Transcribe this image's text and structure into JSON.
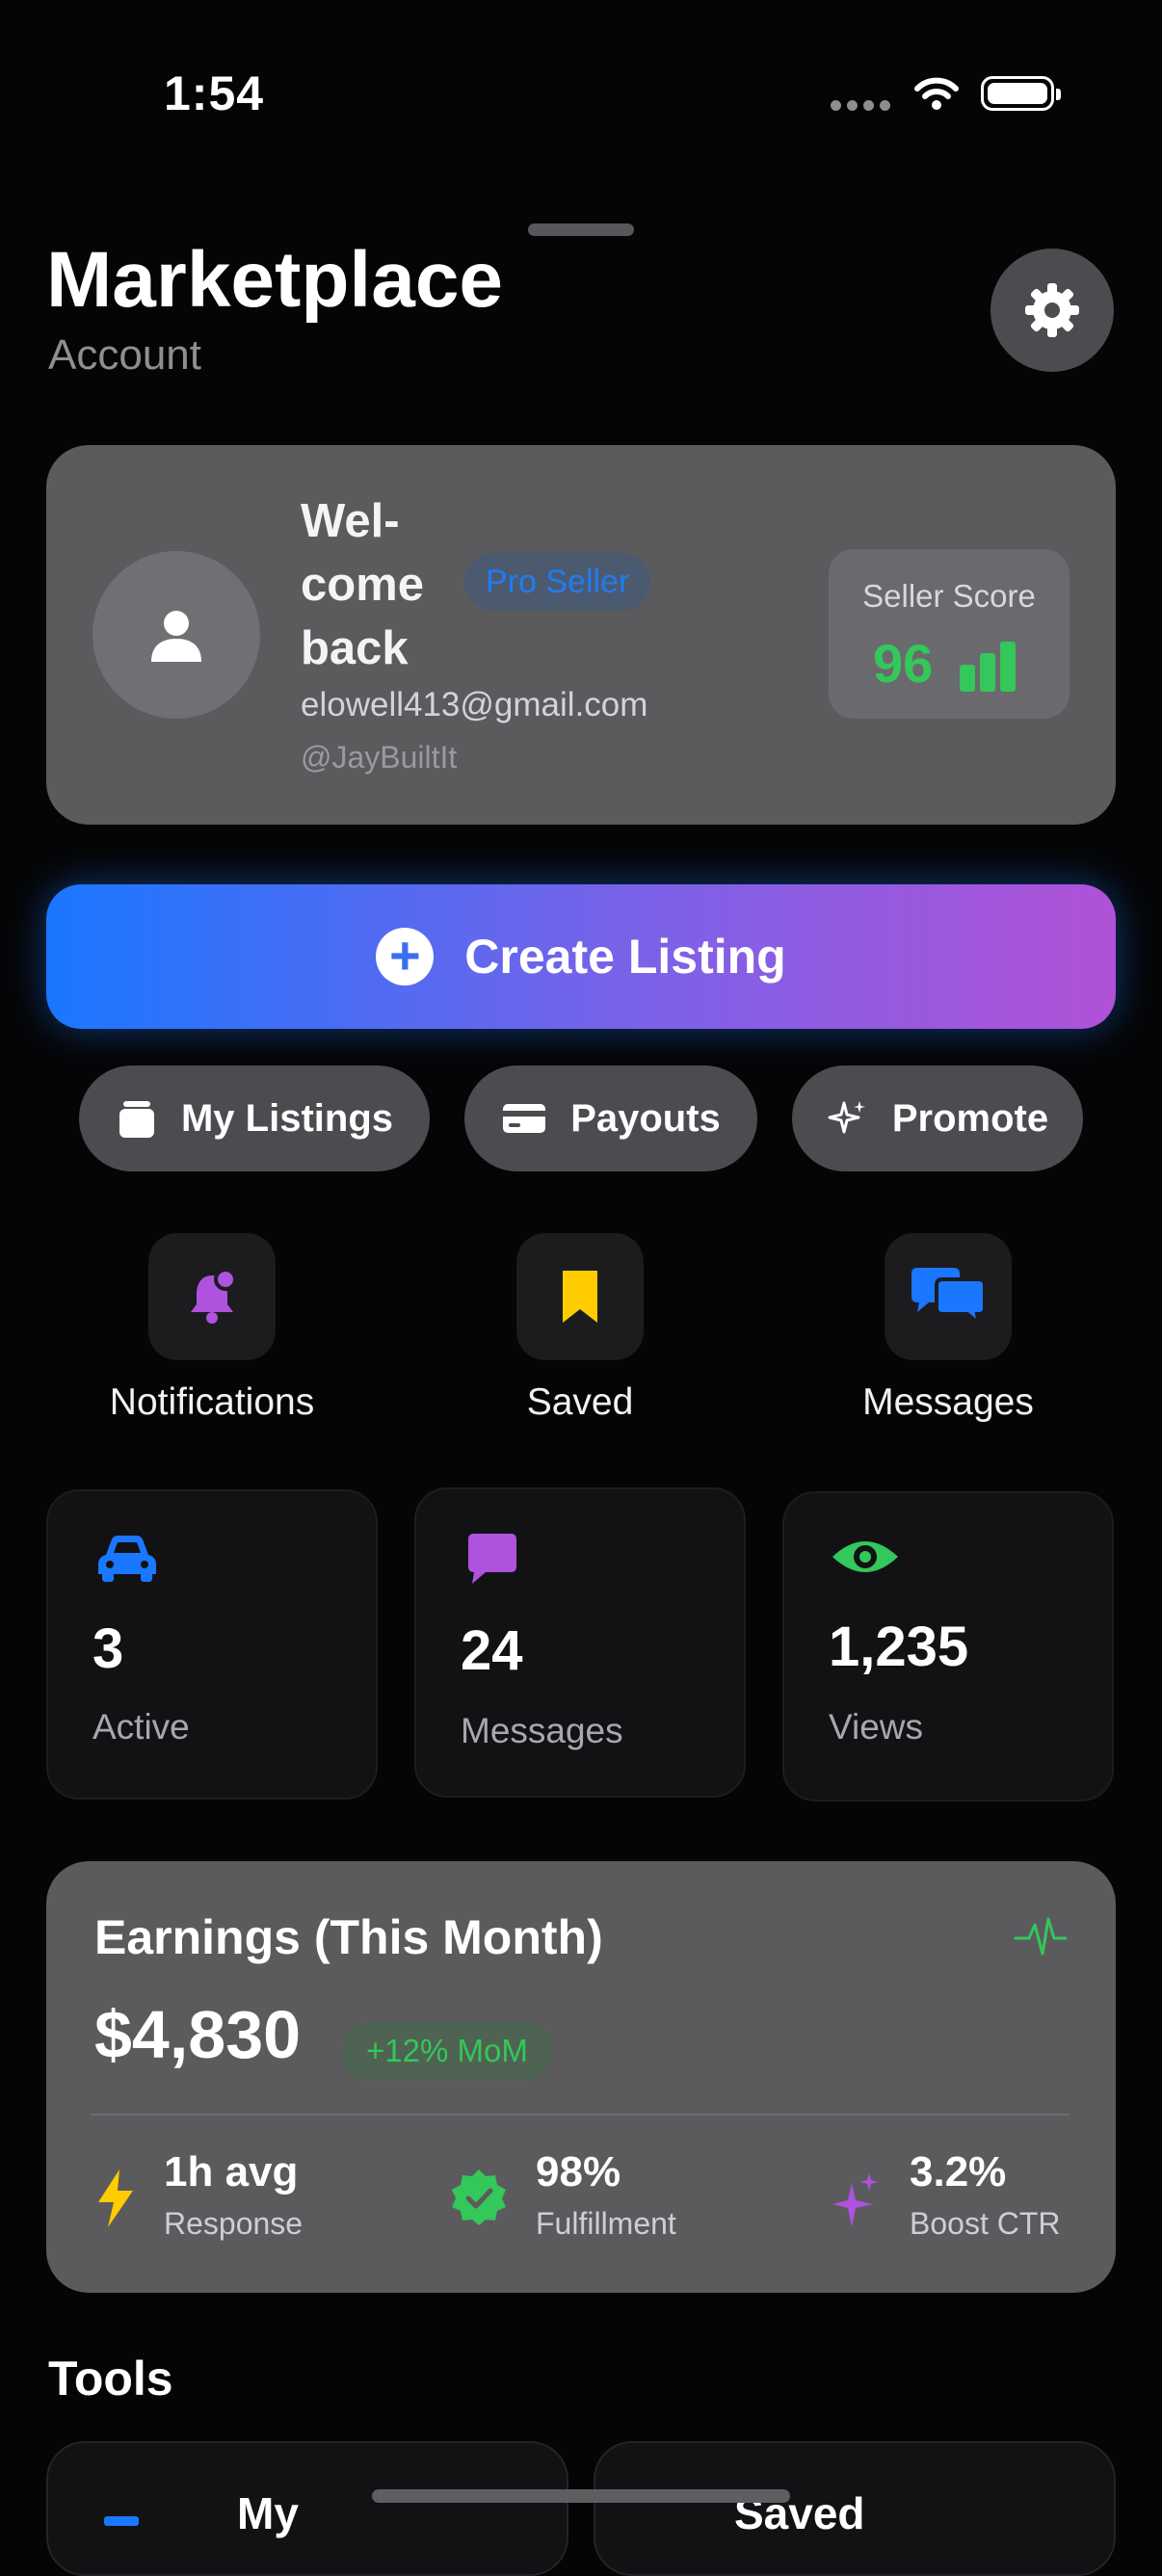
{
  "status_bar": {
    "time": "1:54"
  },
  "header": {
    "title": "Marketplace",
    "subtitle": "Account"
  },
  "profile": {
    "welcome": "Wel- come back",
    "badge": "Pro Seller",
    "email": "elowell413@gmail.com",
    "handle": "@JayBuiltIt",
    "score_label": "Seller Score",
    "score_value": "96"
  },
  "create_listing": {
    "label": "Create Listing"
  },
  "pills": [
    {
      "label": "My Listings",
      "icon": "stack-icon"
    },
    {
      "label": "Payouts",
      "icon": "card-icon"
    },
    {
      "label": "Promote",
      "icon": "sparkles-icon"
    }
  ],
  "quick": [
    {
      "label": "Notifications",
      "icon": "bell-badge-icon",
      "color": "#af52de"
    },
    {
      "label": "Saved",
      "icon": "bookmark-icon",
      "color": "#ffcc00"
    },
    {
      "label": "Messages",
      "icon": "chat-bubbles-icon",
      "color": "#1a77ff"
    }
  ],
  "stats": [
    {
      "value": "3",
      "label": "Active",
      "icon": "car-icon",
      "color": "#1a77ff"
    },
    {
      "value": "24",
      "label": "Messages",
      "icon": "message-icon",
      "color": "#af52de"
    },
    {
      "value": "1,235",
      "label": "Views",
      "icon": "eye-icon",
      "color": "#34c759"
    }
  ],
  "earnings": {
    "title": "Earnings (This Month)",
    "amount": "$4,830",
    "change": "+12% MoM",
    "metrics": [
      {
        "value": "1h avg",
        "label": "Response",
        "icon": "bolt-icon",
        "color": "#ffcc00"
      },
      {
        "value": "98%",
        "label": "Fulfillment",
        "icon": "checkmark-seal-icon",
        "color": "#34c759"
      },
      {
        "value": "3.2%",
        "label": "Boost CTR",
        "icon": "sparkles-icon",
        "color": "#af52de"
      }
    ]
  },
  "tools": {
    "title": "Tools",
    "items": [
      {
        "label": "My"
      },
      {
        "label": "Saved"
      }
    ]
  },
  "colors": {
    "accent_blue": "#1a77ff",
    "accent_purple": "#af52de",
    "accent_green": "#34c759",
    "accent_yellow": "#ffcc00"
  }
}
